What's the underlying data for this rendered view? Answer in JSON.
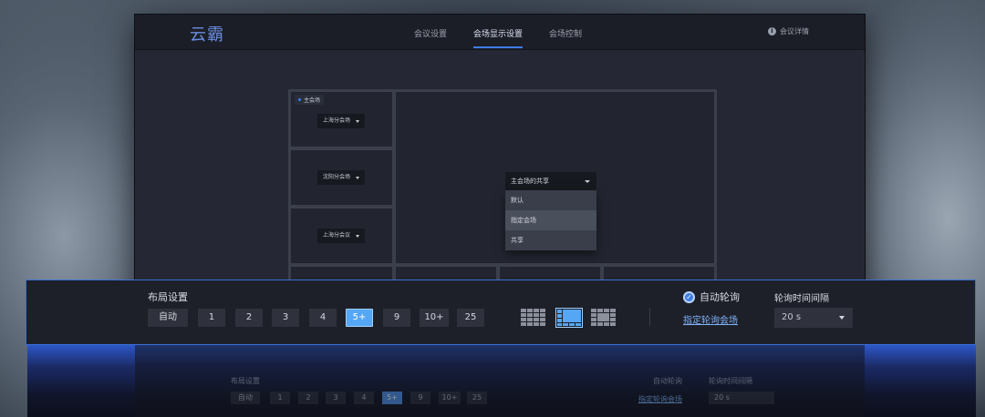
{
  "topbar": {
    "logo": "云霸",
    "tabs": [
      {
        "label": "会议设置",
        "active": false
      },
      {
        "label": "会场显示设置",
        "active": true
      },
      {
        "label": "会场控制",
        "active": false
      }
    ],
    "details_label": "会议详情",
    "details_icon": "info-icon"
  },
  "stage": {
    "main_tag": "主会场",
    "left_selects": [
      "上海分会场",
      "沈阳分会场",
      "上海分会议"
    ],
    "share_select": "主会场的共享",
    "share_options": [
      "默认",
      "指定会场",
      "共享"
    ],
    "hovered_option": "指定会场"
  },
  "panel": {
    "title": "布局设置",
    "layout_buttons": [
      "自动",
      "1",
      "2",
      "3",
      "4",
      "5+",
      "9",
      "10+",
      "25"
    ],
    "active_layout": "5+",
    "layout_styles": [
      "grid-layout-icon",
      "focus-layout-icon",
      "mixed-layout-icon"
    ],
    "active_style": "focus-layout-icon",
    "auto_rotate_label": "自动轮询",
    "auto_rotate_checked": true,
    "specify_link": "指定轮询会场",
    "interval_label": "轮询时间间隔",
    "interval_value": "20 s"
  },
  "colors": {
    "accent": "#3f7df5",
    "active_button": "#55a7f5",
    "panel_border": "#3b6fd8"
  }
}
